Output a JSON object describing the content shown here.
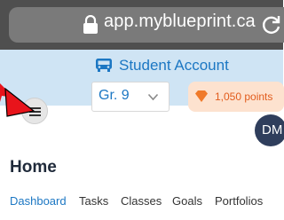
{
  "browser": {
    "url": "app.myblueprint.ca",
    "lock_icon": "lock-icon",
    "reload_icon": "reload-icon"
  },
  "banner": {
    "icon": "bus-icon",
    "label": "Student Account"
  },
  "grade_select": {
    "value": "Gr. 9",
    "chevron_icon": "chevron-down-icon"
  },
  "points": {
    "icon": "gem-icon",
    "label": "1,050 points"
  },
  "menu": {
    "icon": "hamburger-menu-icon"
  },
  "avatar": {
    "initials": "DM"
  },
  "page": {
    "title": "Home"
  },
  "tabs": [
    {
      "label": "Dashboard",
      "active": true
    },
    {
      "label": "Tasks",
      "active": false
    },
    {
      "label": "Classes",
      "active": false
    },
    {
      "label": "Goals",
      "active": false
    },
    {
      "label": "Portfolios",
      "active": false
    }
  ],
  "colors": {
    "accent": "#1c77c3",
    "banner_bg": "#cfe4f4",
    "points_bg": "#fde2cf",
    "points_text": "#e25c1c",
    "annotation_arrow": "#e8141b"
  }
}
